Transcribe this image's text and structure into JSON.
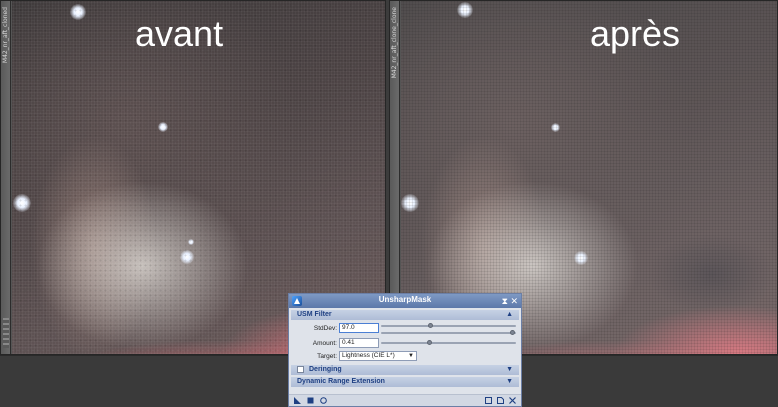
{
  "captions": {
    "left": "avant",
    "right": "après"
  },
  "windows": {
    "left": {
      "id_label": "M42_nr_aft_cloned"
    },
    "right": {
      "id_label": "M42_nr_aft_clone_clone"
    }
  },
  "dialog": {
    "title": "UnsharpMask",
    "titlebar_buttons": {
      "shade": "⧗",
      "close": "✕"
    },
    "usm_section": "USM Filter",
    "stddev_label": "StdDev:",
    "stddev_value": "97.0",
    "amount_label": "Amount:",
    "amount_value": "0.41",
    "target_label": "Target:",
    "target_value": "Lightness (CIE L*)",
    "deringing_section": "Deringing",
    "dre_section": "Dynamic Range Extension",
    "chevron_up": "▲",
    "chevron_down": "▼",
    "sliders": {
      "stddev_fine": 0.37,
      "stddev_coarse": 0.98,
      "amount": 0.36
    }
  },
  "colors": {
    "section_text": "#1e3f82",
    "titlebar": "#5c78a9"
  }
}
